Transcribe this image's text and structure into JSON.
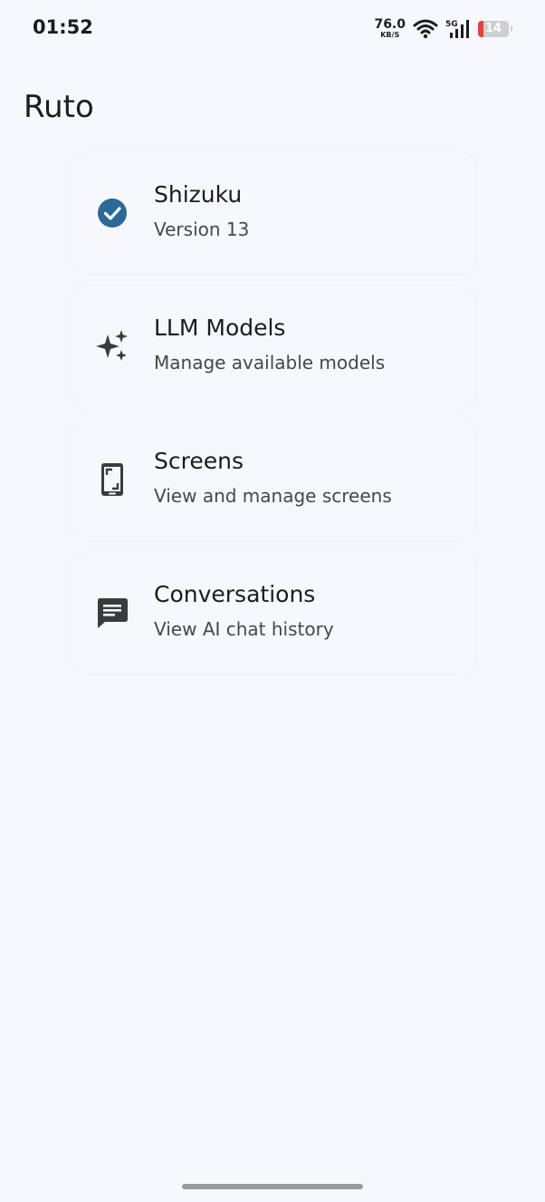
{
  "status_bar": {
    "time": "01:52",
    "net_speed": "76.0",
    "net_unit": "KB/S",
    "network_type": "5G",
    "battery_level": "14",
    "icons": [
      "wifi-icon",
      "signal-icon",
      "battery-icon"
    ]
  },
  "app": {
    "title": "Ruto"
  },
  "menu": {
    "items": [
      {
        "title": "Shizuku",
        "subtitle": "Version 13",
        "icon": "check-circle-icon",
        "icon_color": "#2b6a96"
      },
      {
        "title": "LLM Models",
        "subtitle": "Manage available models",
        "icon": "sparkles-icon",
        "icon_color": "#3a3b3f"
      },
      {
        "title": "Screens",
        "subtitle": "View and manage screens",
        "icon": "phone-screen-icon",
        "icon_color": "#3a3b3f"
      },
      {
        "title": "Conversations",
        "subtitle": "View AI chat history",
        "icon": "chat-icon",
        "icon_color": "#3a3b3f"
      }
    ]
  },
  "colors": {
    "background": "#f7f8fc",
    "accent": "#2b6a96",
    "text_primary": "#1b1c1f",
    "text_secondary": "#46474c",
    "battery_low": "#e0443e"
  }
}
